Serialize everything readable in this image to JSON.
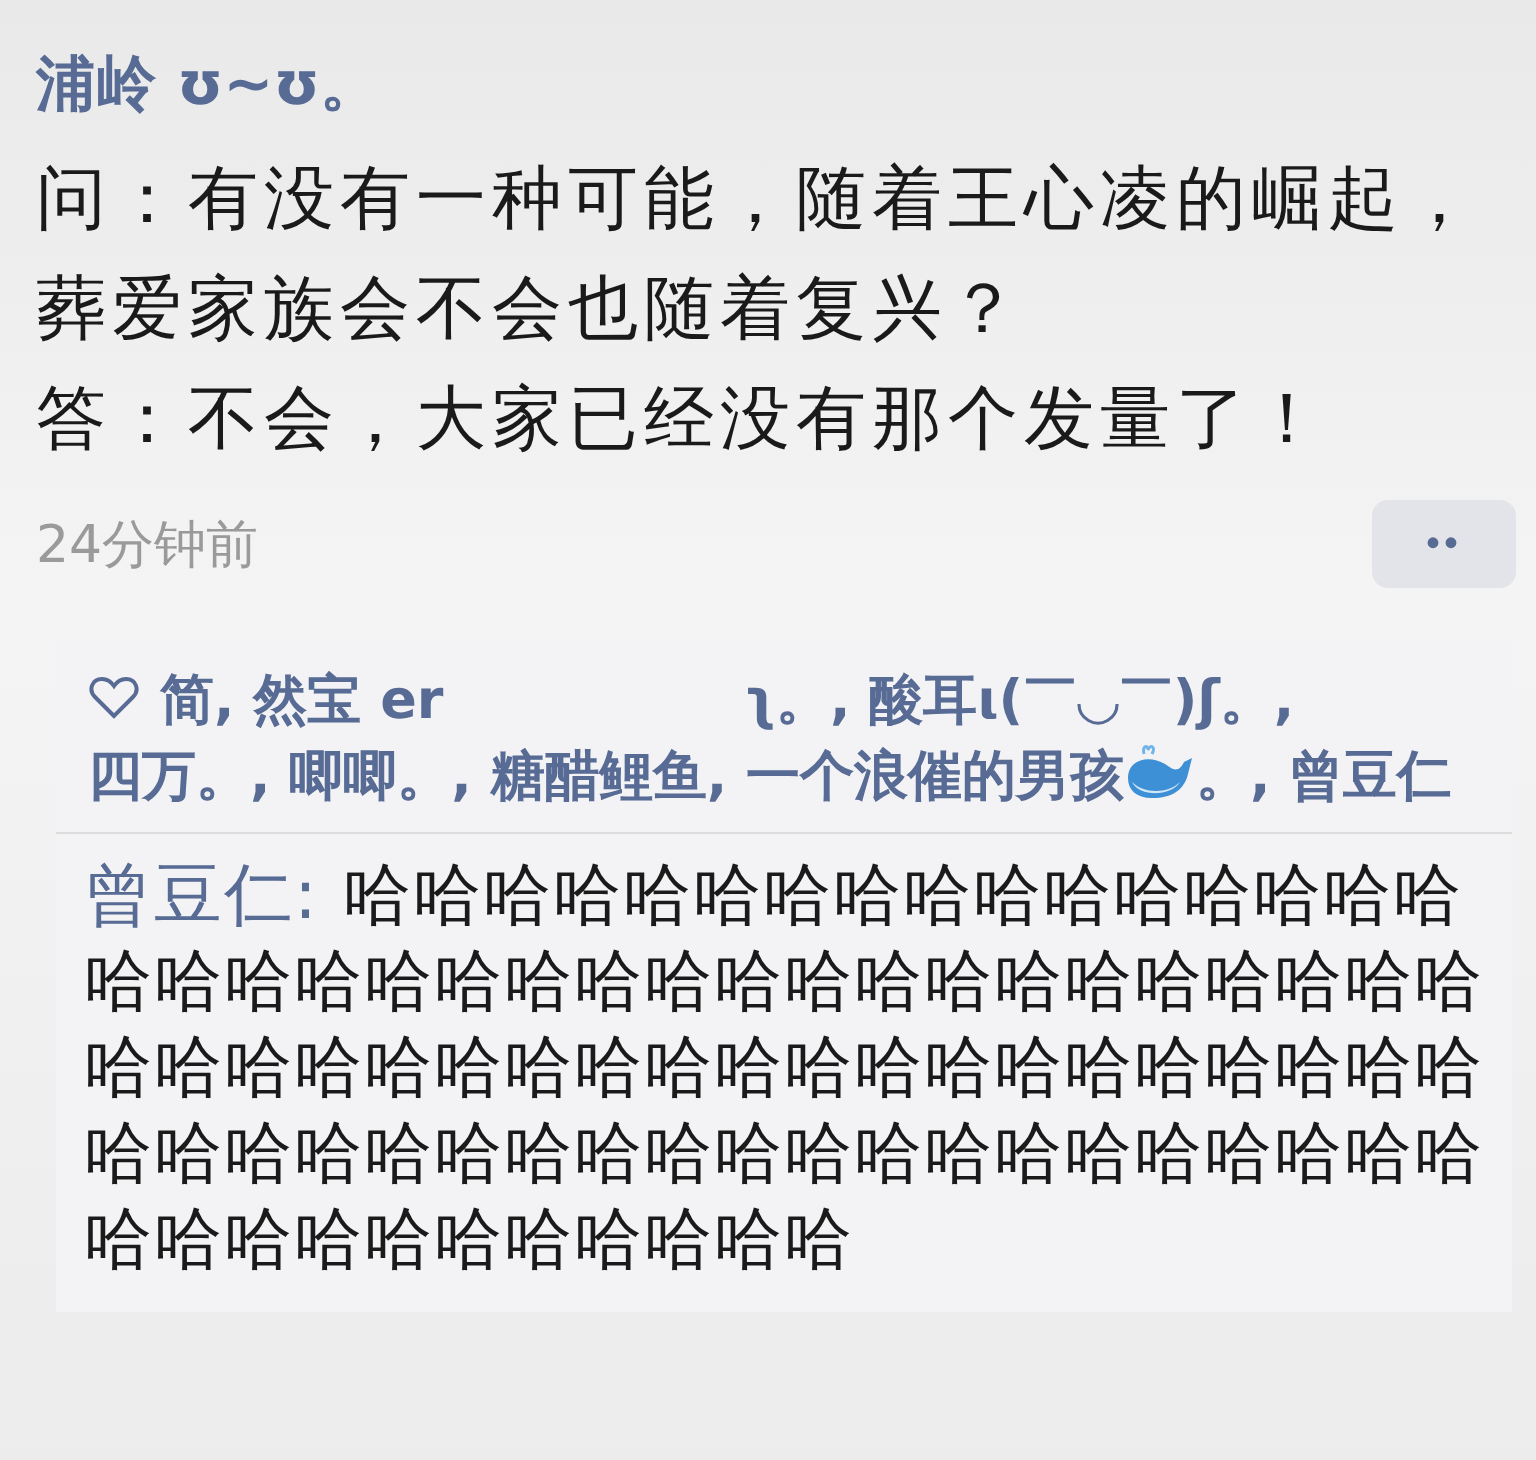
{
  "post": {
    "author": "浦岭 ʊ~ʊ。",
    "paragraphs": [
      "问：有没有一种可能，随着王心凌的崛起，葬爱家族会不会也随着复兴？",
      "答：不会，大家已经没有那个发量了！"
    ],
    "time": "24分钟前",
    "more": "••"
  },
  "likes": {
    "separator": ",",
    "likers": [
      {
        "kind": "plain",
        "name": "简"
      },
      {
        "kind": "gapped",
        "name": "然宝 er",
        "tail": "ʅ。"
      },
      {
        "kind": "plain",
        "name": "酸耳ι(￣◡￣)ʃ。"
      },
      {
        "kind": "plain",
        "name": "四万。"
      },
      {
        "kind": "plain",
        "name": "唧唧。"
      },
      {
        "kind": "plain",
        "name": "糖醋鲤鱼"
      },
      {
        "kind": "emoji",
        "name": "一个浪催的男孩",
        "tail": "。"
      },
      {
        "kind": "plain",
        "name": "曾豆仁"
      }
    ]
  },
  "comments": [
    {
      "author": "曾豆仁",
      "separator": ":",
      "text": "哈哈哈哈哈哈哈哈哈哈哈哈哈哈哈哈哈哈哈哈哈哈哈哈哈哈哈哈哈哈哈哈哈哈哈哈哈哈哈哈哈哈哈哈哈哈哈哈哈哈哈哈哈哈哈哈哈哈哈哈哈哈哈哈哈哈哈哈哈哈哈哈哈哈哈哈哈哈哈哈哈哈哈哈哈哈哈"
    }
  ]
}
